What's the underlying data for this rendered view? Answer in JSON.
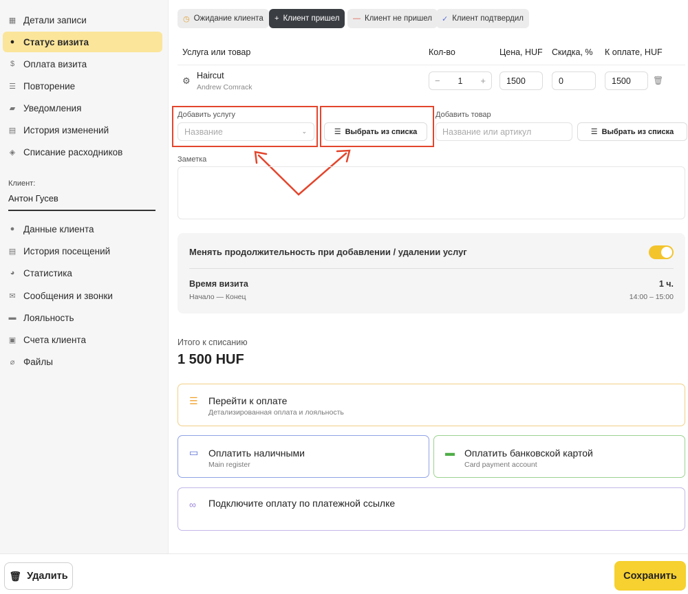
{
  "sidebar": {
    "items": [
      {
        "label": "Детали записи",
        "icon": "calendar-icon"
      },
      {
        "label": "Статус визита",
        "icon": "clock-icon",
        "active": true
      },
      {
        "label": "Оплата визита",
        "icon": "dollar-icon"
      },
      {
        "label": "Повторение",
        "icon": "list-icon"
      },
      {
        "label": "Уведомления",
        "icon": "chat-icon"
      },
      {
        "label": "История изменений",
        "icon": "document-icon"
      },
      {
        "label": "Списание расходников",
        "icon": "boxes-icon"
      }
    ],
    "client_label": "Клиент:",
    "client_name": "Антон  Гусев",
    "client_items": [
      {
        "label": "Данные клиента",
        "icon": "person-icon"
      },
      {
        "label": "История посещений",
        "icon": "history-icon"
      },
      {
        "label": "Статистика",
        "icon": "pie-chart-icon"
      },
      {
        "label": "Сообщения и звонки",
        "icon": "envelope-icon"
      },
      {
        "label": "Лояльность",
        "icon": "card-icon"
      },
      {
        "label": "Счета клиента",
        "icon": "briefcase-icon"
      },
      {
        "label": "Файлы",
        "icon": "paperclip-icon"
      }
    ]
  },
  "status_chips": [
    {
      "label": "Ожидание клиента",
      "icon": "clock-icon"
    },
    {
      "label": "Клиент пришел",
      "icon": "plus-icon",
      "selected": true
    },
    {
      "label": "Клиент не пришел",
      "icon": "minus-icon"
    },
    {
      "label": "Клиент подтвердил",
      "icon": "check-icon"
    }
  ],
  "table": {
    "headers": [
      "Услуга или товар",
      "Кол-во",
      "Цена, HUF",
      "Скидка, %",
      "К оплате, HUF"
    ],
    "rows": [
      {
        "name": "Haircut",
        "staff": "Andrew Comrack",
        "qty": "1",
        "price": "1500",
        "discount": "0",
        "total": "1500"
      }
    ]
  },
  "add_service": {
    "label": "Добавить услугу",
    "placeholder": "Название",
    "list_button": "Выбрать из списка"
  },
  "add_product": {
    "label": "Добавить товар",
    "placeholder": "Название или артикул",
    "list_button": "Выбрать из списка"
  },
  "note": {
    "label": "Заметка"
  },
  "duration": {
    "toggle_label": "Менять продолжительность при добавлении / удалении услуг",
    "toggle_on": true,
    "time_title": "Время визита",
    "time_sub": "Начало — Конец",
    "time_value": "1 ч.",
    "time_range": "14:00 – 15:00"
  },
  "total": {
    "label": "Итого к списанию",
    "value": "1 500 HUF"
  },
  "payments": {
    "go_to_payment": {
      "title": "Перейти к оплате",
      "subtitle": "Детализированная оплата и лояльность"
    },
    "cash": {
      "title": "Оплатить наличными",
      "subtitle": "Main register"
    },
    "card": {
      "title": "Оплатить банковской картой",
      "subtitle": "Card payment account"
    },
    "link": {
      "title": "Подключите оплату по платежной ссылке"
    }
  },
  "footer": {
    "delete_label": "Удалить",
    "save_label": "Сохранить"
  },
  "colors": {
    "accent": "#f6d12f",
    "highlight": "#e3452c",
    "active_nav": "#fbe59a"
  }
}
